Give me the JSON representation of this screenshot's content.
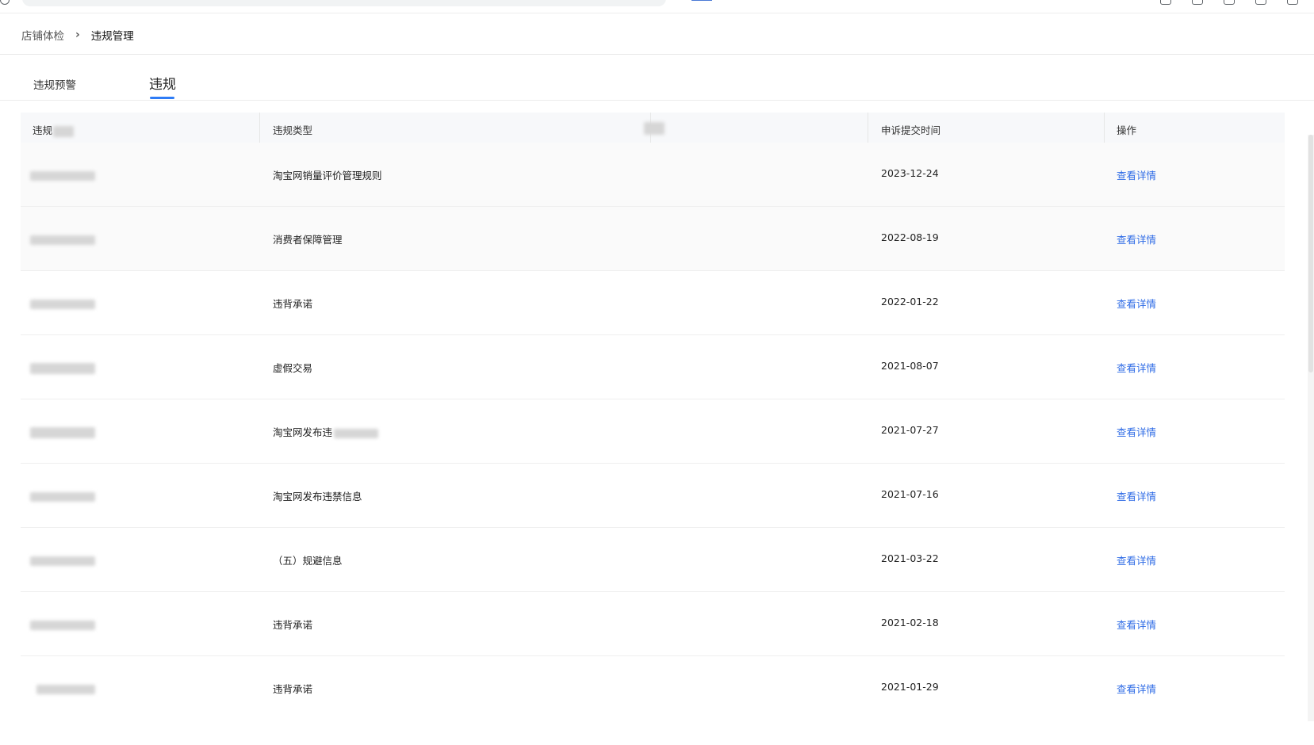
{
  "breadcrumb": {
    "parent": "店铺体检",
    "separator": "›",
    "current": "违规管理"
  },
  "tabs": [
    {
      "label": "违规预警",
      "active": false
    },
    {
      "label": "违规",
      "active": true
    }
  ],
  "table": {
    "headers": {
      "col1": "违规",
      "col2": "违规类型",
      "col4": "申诉提交时间",
      "col5": "操作"
    },
    "rows": [
      {
        "type": "淘宝网销量评价管理规则",
        "date": "2023-12-24",
        "action": "查看详情"
      },
      {
        "type": "消费者保障管理",
        "date": "2022-08-19",
        "action": "查看详情"
      },
      {
        "type": "违背承诺",
        "date": "2022-01-22",
        "action": "查看详情"
      },
      {
        "type": "虚假交易",
        "date": "2021-08-07",
        "action": "查看详情"
      },
      {
        "type": "淘宝网发布违",
        "date": "2021-07-27",
        "action": "查看详情"
      },
      {
        "type": "淘宝网发布违禁信息",
        "date": "2021-07-16",
        "action": "查看详情"
      },
      {
        "type": "（五）规避信息",
        "date": "2021-03-22",
        "action": "查看详情"
      },
      {
        "type": "违背承诺",
        "date": "2021-02-18",
        "action": "查看详情"
      },
      {
        "type": "违背承诺",
        "date": "2021-01-29",
        "action": "查看详情"
      }
    ]
  },
  "colors": {
    "accent": "#2e7cf6",
    "link": "#2e6be6",
    "header_bg": "#f7f8fa"
  }
}
